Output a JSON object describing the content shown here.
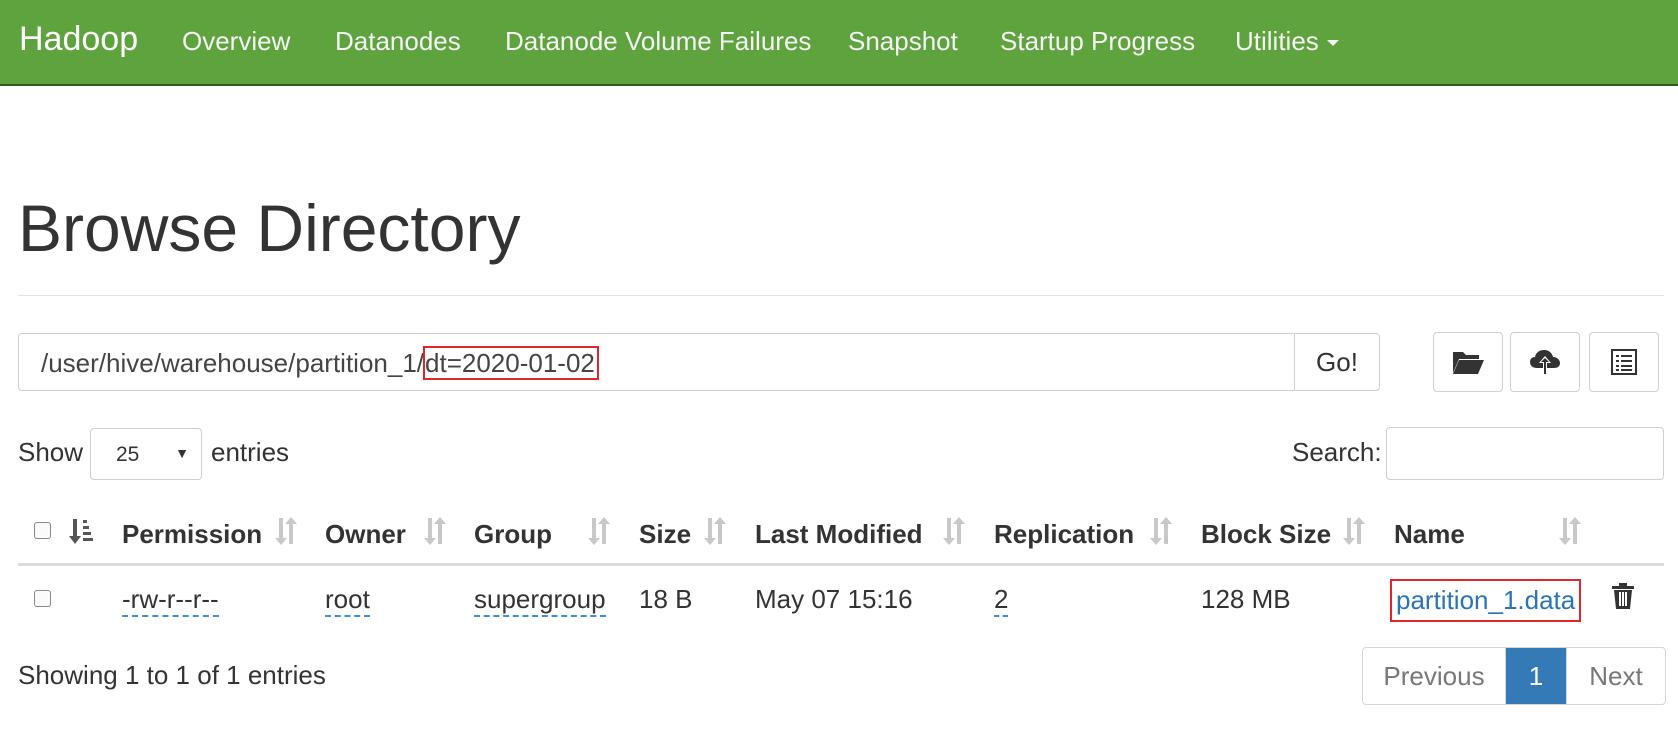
{
  "navbar": {
    "brand": "Hadoop",
    "items": [
      "Overview",
      "Datanodes",
      "Datanode Volume Failures",
      "Snapshot",
      "Startup Progress",
      "Utilities"
    ]
  },
  "page": {
    "title": "Browse Directory"
  },
  "path_bar": {
    "prefix": "/user/hive/warehouse/partition_1/",
    "highlighted": "dt=2020-01-02",
    "go_label": "Go!"
  },
  "toolbar": {
    "icons": [
      "folder-open-icon",
      "cloud-upload-icon",
      "list-icon"
    ]
  },
  "length_menu": {
    "show_label": "Show",
    "value": "25",
    "entries_label": "entries"
  },
  "search": {
    "label": "Search:",
    "value": ""
  },
  "table": {
    "columns": [
      "Permission",
      "Owner",
      "Group",
      "Size",
      "Last Modified",
      "Replication",
      "Block Size",
      "Name"
    ],
    "rows": [
      {
        "permission": "-rw-r--r--",
        "owner": "root",
        "group": "supergroup",
        "size": "18 B",
        "last_modified": "May 07 15:16",
        "replication": "2",
        "block_size": "128 MB",
        "name": "partition_1.data"
      }
    ]
  },
  "footer": {
    "info": "Showing 1 to 1 of 1 entries",
    "pagination": {
      "previous": "Previous",
      "current": "1",
      "next": "Next"
    }
  },
  "colors": {
    "navbar": "#5fa33e",
    "link": "#2a73b4",
    "highlight_border": "#e0262c",
    "active_page": "#337ab7"
  }
}
